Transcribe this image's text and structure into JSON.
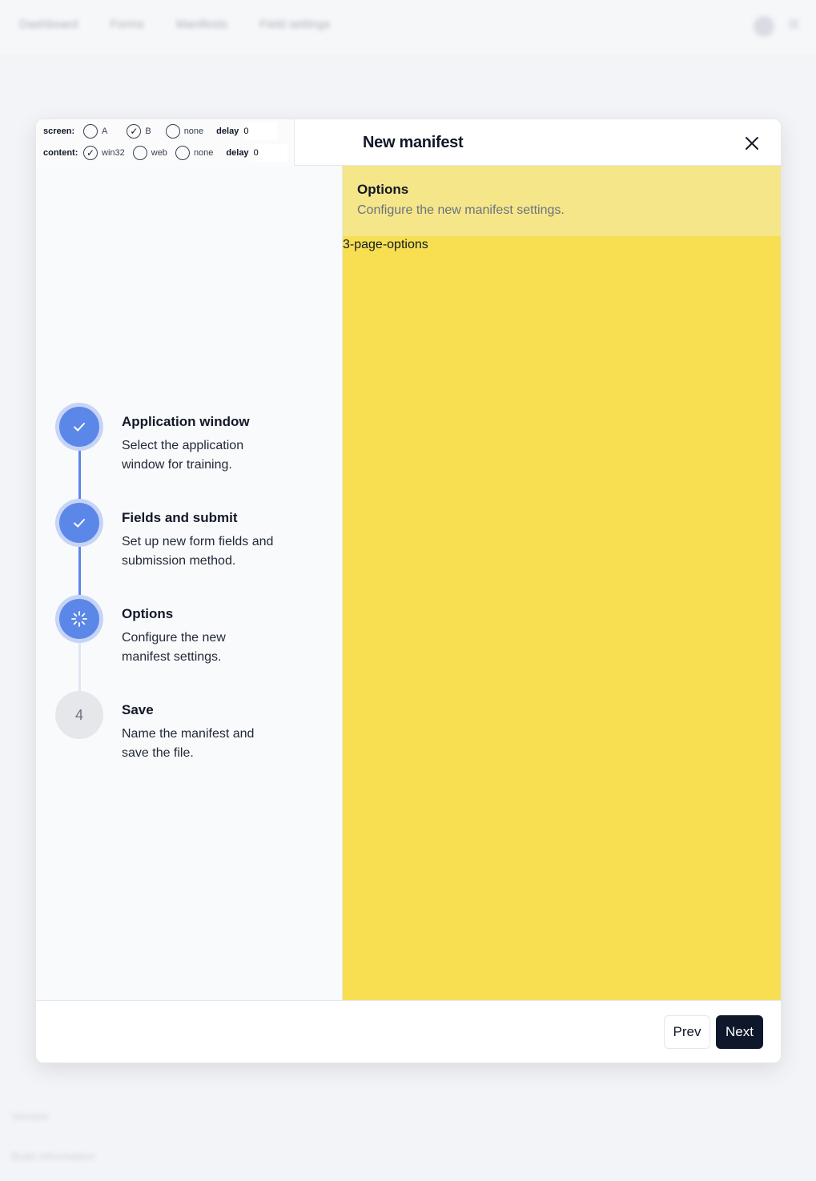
{
  "background": {
    "nav_items": [
      "Dashboard",
      "Forms",
      "Manifests",
      "Field settings"
    ],
    "footer_lines": [
      "Version",
      "Build information"
    ]
  },
  "debug": {
    "screen_label": "screen:",
    "screen_options": [
      {
        "label": "A",
        "checked": false
      },
      {
        "label": "B",
        "checked": true
      },
      {
        "label": "none",
        "checked": false
      }
    ],
    "content_label": "content:",
    "content_options": [
      {
        "label": "win32",
        "checked": true
      },
      {
        "label": "web",
        "checked": false
      },
      {
        "label": "none",
        "checked": false
      }
    ],
    "delay_label": "delay",
    "screen_delay": "0",
    "content_delay": "0"
  },
  "modal": {
    "title": "New manifest",
    "close_icon": "close-icon"
  },
  "steps": [
    {
      "title": "Application window",
      "description": "Select the application window for training.",
      "state": "complete",
      "icon": "check-icon"
    },
    {
      "title": "Fields and submit",
      "description": "Set up new form fields and submission method.",
      "state": "complete",
      "icon": "check-icon"
    },
    {
      "title": "Options",
      "description": "Configure the new manifest settings.",
      "state": "active",
      "icon": "loading-icon"
    },
    {
      "title": "Save",
      "description": "Name the manifest and save the file.",
      "state": "pending",
      "number": "4"
    }
  ],
  "content": {
    "title": "Options",
    "subtitle": "Configure the new manifest settings.",
    "page_marker": "3-page-options"
  },
  "footer": {
    "prev_label": "Prev",
    "next_label": "Next"
  },
  "colors": {
    "accent": "#5b87e8",
    "content_bg": "#f7df51",
    "content_header_bg": "#f5e689",
    "primary_button": "#0f172a"
  }
}
